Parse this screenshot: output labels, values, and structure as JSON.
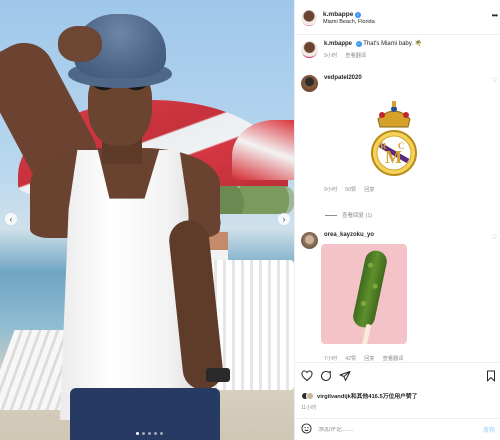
{
  "post": {
    "username": "k.mbappe",
    "location": "Miami Beach, Florida",
    "more_label": "•••",
    "caption_text": "That's Miami baby. 🌴",
    "caption_time": "9小时",
    "caption_translate": "查看翻译"
  },
  "comments": [
    {
      "username": "vedpatel2020",
      "time": "9小时",
      "likes": "50赞",
      "reply": "回复",
      "view_replies": "查看回复 (1)"
    },
    {
      "username": "orea_kayzoku_yo",
      "time": "7小时",
      "likes": "42赞",
      "reply": "回复",
      "translate": "查看翻译"
    }
  ],
  "likes_text": "virgilvandijk和其他416.5万位用户赞了",
  "posted_time": "11小时",
  "add_comment": {
    "placeholder": "添加评论……",
    "post_label": "发布"
  },
  "carousel": {
    "prev": "‹",
    "next": "›",
    "total_slides": 5,
    "active_slide": 1
  },
  "colors": {
    "verified": "#3897f0",
    "muted": "#8e8e8e",
    "post_button": "#b3dbff"
  },
  "icons": [
    "heart-icon",
    "comment-icon",
    "share-icon",
    "bookmark-icon",
    "emoji-icon",
    "more-icon"
  ]
}
